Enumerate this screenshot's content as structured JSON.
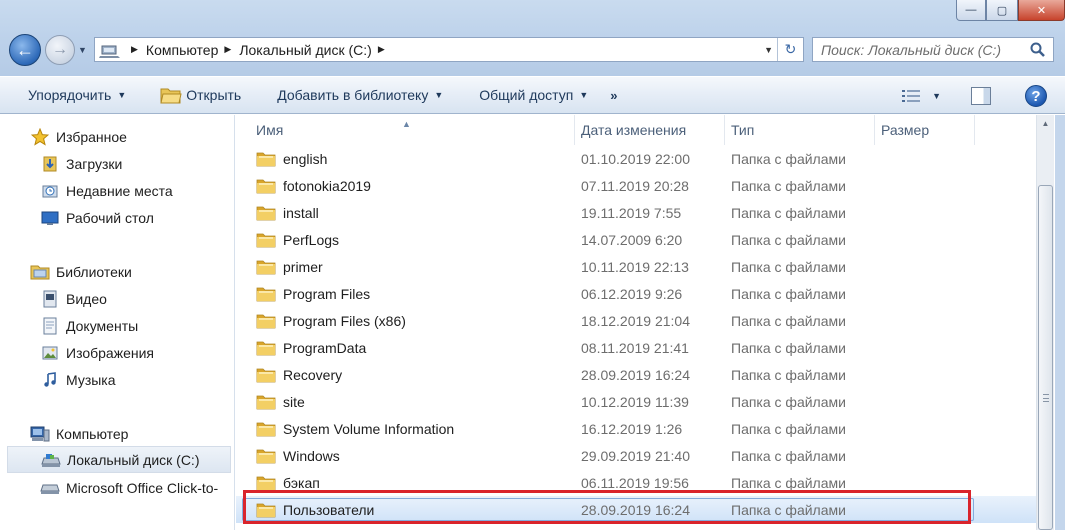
{
  "window": {
    "buttons": [
      {
        "name": "minimize",
        "glyph": "—"
      },
      {
        "name": "maximize",
        "glyph": "▢"
      },
      {
        "name": "close",
        "glyph": "✕"
      }
    ]
  },
  "nav": {
    "back_glyph": "←",
    "forward_glyph": "→",
    "dropdown_glyph": "▼"
  },
  "address": {
    "breadcrumbs": [
      {
        "label": "Компьютер"
      },
      {
        "label": "Локальный диск (C:)"
      }
    ],
    "separator_glyph": "▶",
    "dropdown_glyph": "▼",
    "refresh_glyph": "↻",
    "computer_icon": "computer-icon"
  },
  "search": {
    "placeholder": "Поиск: Локальный диск (C:)",
    "icon": "search-icon"
  },
  "toolbar": {
    "organize": "Упорядочить",
    "open": "Открыть",
    "add_library": "Добавить в библиотеку",
    "share": "Общий доступ",
    "more": "»",
    "dropdown_glyph": "▼",
    "help": "?"
  },
  "sidebar": {
    "favorites": {
      "label": "Избранное",
      "items": [
        {
          "label": "Загрузки",
          "icon": "downloads-icon"
        },
        {
          "label": "Недавние места",
          "icon": "recent-places-icon"
        },
        {
          "label": "Рабочий стол",
          "icon": "desktop-icon"
        }
      ]
    },
    "libraries": {
      "label": "Библиотеки",
      "items": [
        {
          "label": "Видео",
          "icon": "video-icon"
        },
        {
          "label": "Документы",
          "icon": "documents-icon"
        },
        {
          "label": "Изображения",
          "icon": "pictures-icon"
        },
        {
          "label": "Музыка",
          "icon": "music-icon"
        }
      ]
    },
    "computer": {
      "label": "Компьютер",
      "items": [
        {
          "label": "Локальный диск (C:)",
          "icon": "drive-icon"
        },
        {
          "label": "Microsoft Office Click-to-",
          "icon": "office-drive-icon"
        }
      ]
    }
  },
  "list": {
    "columns": {
      "name": "Имя",
      "date": "Дата изменения",
      "type": "Тип",
      "size": "Размер"
    },
    "sort_glyph": "▲",
    "rows": [
      {
        "name": "english",
        "date": "01.10.2019 22:00",
        "type": "Папка с файлами",
        "size": ""
      },
      {
        "name": "fotonokia2019",
        "date": "07.11.2019 20:28",
        "type": "Папка с файлами",
        "size": ""
      },
      {
        "name": "install",
        "date": "19.11.2019 7:55",
        "type": "Папка с файлами",
        "size": ""
      },
      {
        "name": "PerfLogs",
        "date": "14.07.2009 6:20",
        "type": "Папка с файлами",
        "size": ""
      },
      {
        "name": "primer",
        "date": "10.11.2019 22:13",
        "type": "Папка с файлами",
        "size": ""
      },
      {
        "name": "Program Files",
        "date": "06.12.2019 9:26",
        "type": "Папка с файлами",
        "size": ""
      },
      {
        "name": "Program Files (x86)",
        "date": "18.12.2019 21:04",
        "type": "Папка с файлами",
        "size": ""
      },
      {
        "name": "ProgramData",
        "date": "08.11.2019 21:41",
        "type": "Папка с файлами",
        "size": ""
      },
      {
        "name": "Recovery",
        "date": "28.09.2019 16:24",
        "type": "Папка с файлами",
        "size": ""
      },
      {
        "name": "site",
        "date": "10.12.2019 11:39",
        "type": "Папка с файлами",
        "size": ""
      },
      {
        "name": "System Volume Information",
        "date": "16.12.2019 1:26",
        "type": "Папка с файлами",
        "size": ""
      },
      {
        "name": "Windows",
        "date": "29.09.2019 21:40",
        "type": "Папка с файлами",
        "size": ""
      },
      {
        "name": "бэкап",
        "date": "06.11.2019 19:56",
        "type": "Папка с файлами",
        "size": ""
      },
      {
        "name": "Пользователи",
        "date": "28.09.2019 16:24",
        "type": "Папка с файлами",
        "size": "",
        "selected": true
      }
    ]
  },
  "colors": {
    "folder": "#e8b93a",
    "highlight": "#d9242c",
    "selection": "#cfe2f8"
  }
}
